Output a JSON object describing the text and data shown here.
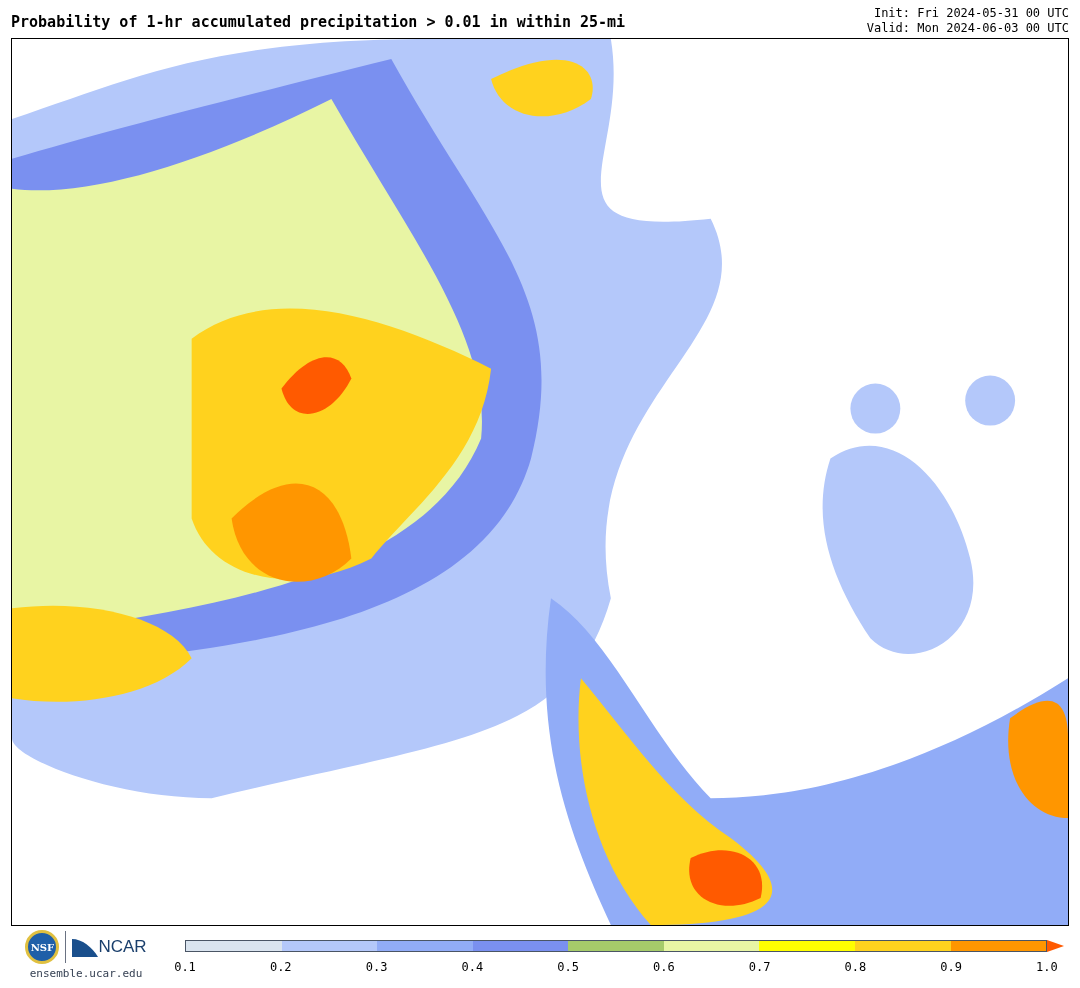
{
  "title": "Probability of 1-hr accumulated precipitation > 0.01 in within 25-mi",
  "init": "Init: Fri 2024-05-31 00 UTC",
  "valid": "Valid: Mon 2024-06-03 00 UTC",
  "logos": {
    "nsf": "NSF",
    "ncar": "NCAR",
    "site": "ensemble.ucar.edu"
  },
  "colorbar": {
    "bins": [
      {
        "color": "#dae4ef"
      },
      {
        "color": "#b4c8fa"
      },
      {
        "color": "#91acf7"
      },
      {
        "color": "#7a90f0"
      },
      {
        "color": "#a6cb6a"
      },
      {
        "color": "#e8f5a4"
      },
      {
        "color": "#ffff00"
      },
      {
        "color": "#ffd21e"
      },
      {
        "color": "#ff9600"
      },
      {
        "color": "#ff5a00",
        "kind": "arrow"
      }
    ],
    "ticks": [
      "0.1",
      "0.2",
      "0.3",
      "0.4",
      "0.5",
      "0.6",
      "0.7",
      "0.8",
      "0.9",
      "1.0"
    ]
  }
}
